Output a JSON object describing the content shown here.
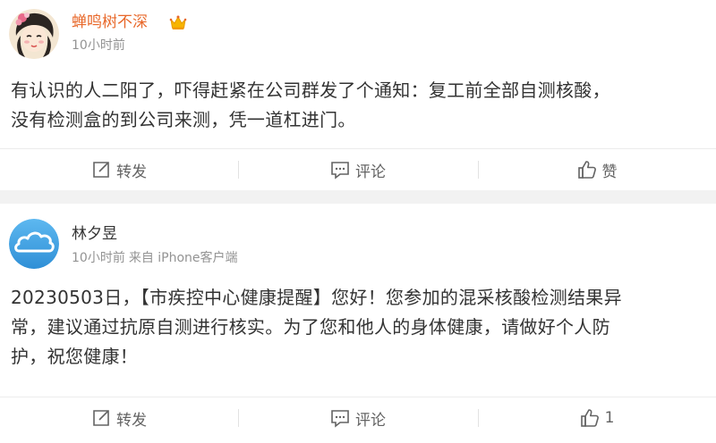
{
  "posts": [
    {
      "username": "蝉鸣树不深",
      "time": "10小时前",
      "source": "",
      "content_lines": [
        "有认识的人二阳了，吓得赶紧在公司群发了个通知：复工前全部自测核酸，",
        "没有检测盒的到公司来测，凭一道杠进门。"
      ],
      "actions": {
        "repost_label": "转发",
        "comment_label": "评论",
        "like_label": "赞"
      },
      "colors": {
        "username": "#e8682a"
      },
      "icons": [
        "avatar-illustration",
        "vip-crown-icon"
      ]
    },
    {
      "username": "林夕昱",
      "time": "10小时前",
      "source": "来自 iPhone客户端",
      "content_lines": [
        "20230503日，【市疾控中心健康提醒】您好！您参加的混采核酸检测结果异",
        "常，建议通过抗原自测进行核实。为了您和他人的身体健康，请做好个人防",
        "护，祝您健康！"
      ],
      "actions": {
        "repost_label": "转发",
        "comment_label": "评论",
        "like_label": "1"
      },
      "colors": {
        "username": "#333333"
      },
      "icons": [
        "default-avatar-cloud"
      ]
    }
  ],
  "colors": {
    "meta": "#939393",
    "action": "#636363",
    "background": "#f2f2f2"
  },
  "action_icons": [
    "repost-icon",
    "comment-icon",
    "like-icon"
  ]
}
